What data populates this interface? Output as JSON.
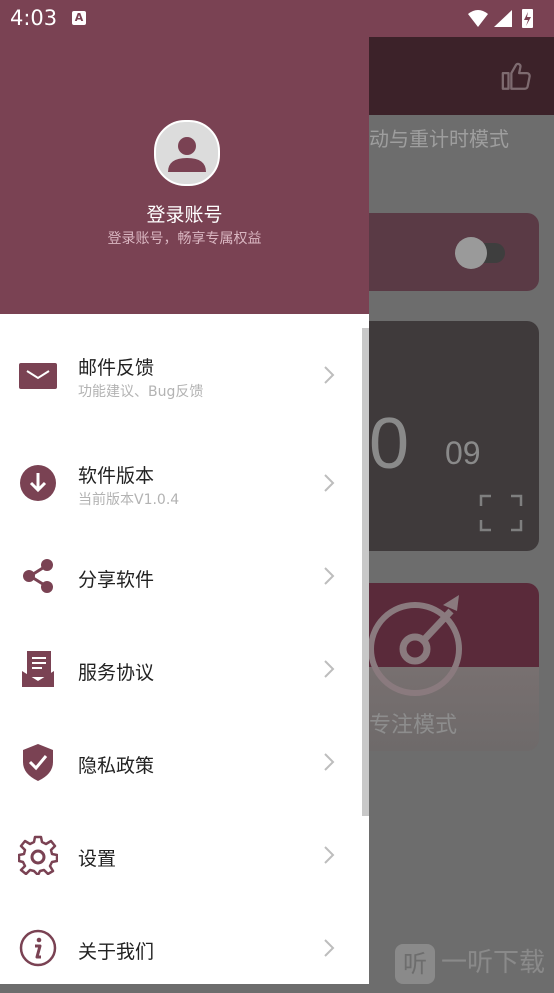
{
  "status_bar": {
    "time": "4:03",
    "notification_icon": "A"
  },
  "background": {
    "mode_text": "动与重计时模式",
    "timer_big": "0",
    "timer_small": "09",
    "focus_label": "专注模式",
    "watermark": "一听下载",
    "watermark_logo": "听"
  },
  "drawer": {
    "header": {
      "title": "登录账号",
      "subtitle": "登录账号，畅享专属权益"
    },
    "items": [
      {
        "title": "邮件反馈",
        "subtitle": "功能建议、Bug反馈",
        "icon": "mail-icon"
      },
      {
        "title": "软件版本",
        "subtitle": "当前版本V1.0.4",
        "icon": "download-icon"
      },
      {
        "title": "分享软件",
        "icon": "share-icon"
      },
      {
        "title": "服务协议",
        "icon": "agreement-icon"
      },
      {
        "title": "隐私政策",
        "icon": "shield-check-icon"
      },
      {
        "title": "设置",
        "icon": "gear-icon"
      },
      {
        "title": "关于我们",
        "icon": "info-icon"
      }
    ]
  },
  "colors": {
    "accent": "#7a4253",
    "scrim": "#6d6d6d"
  }
}
